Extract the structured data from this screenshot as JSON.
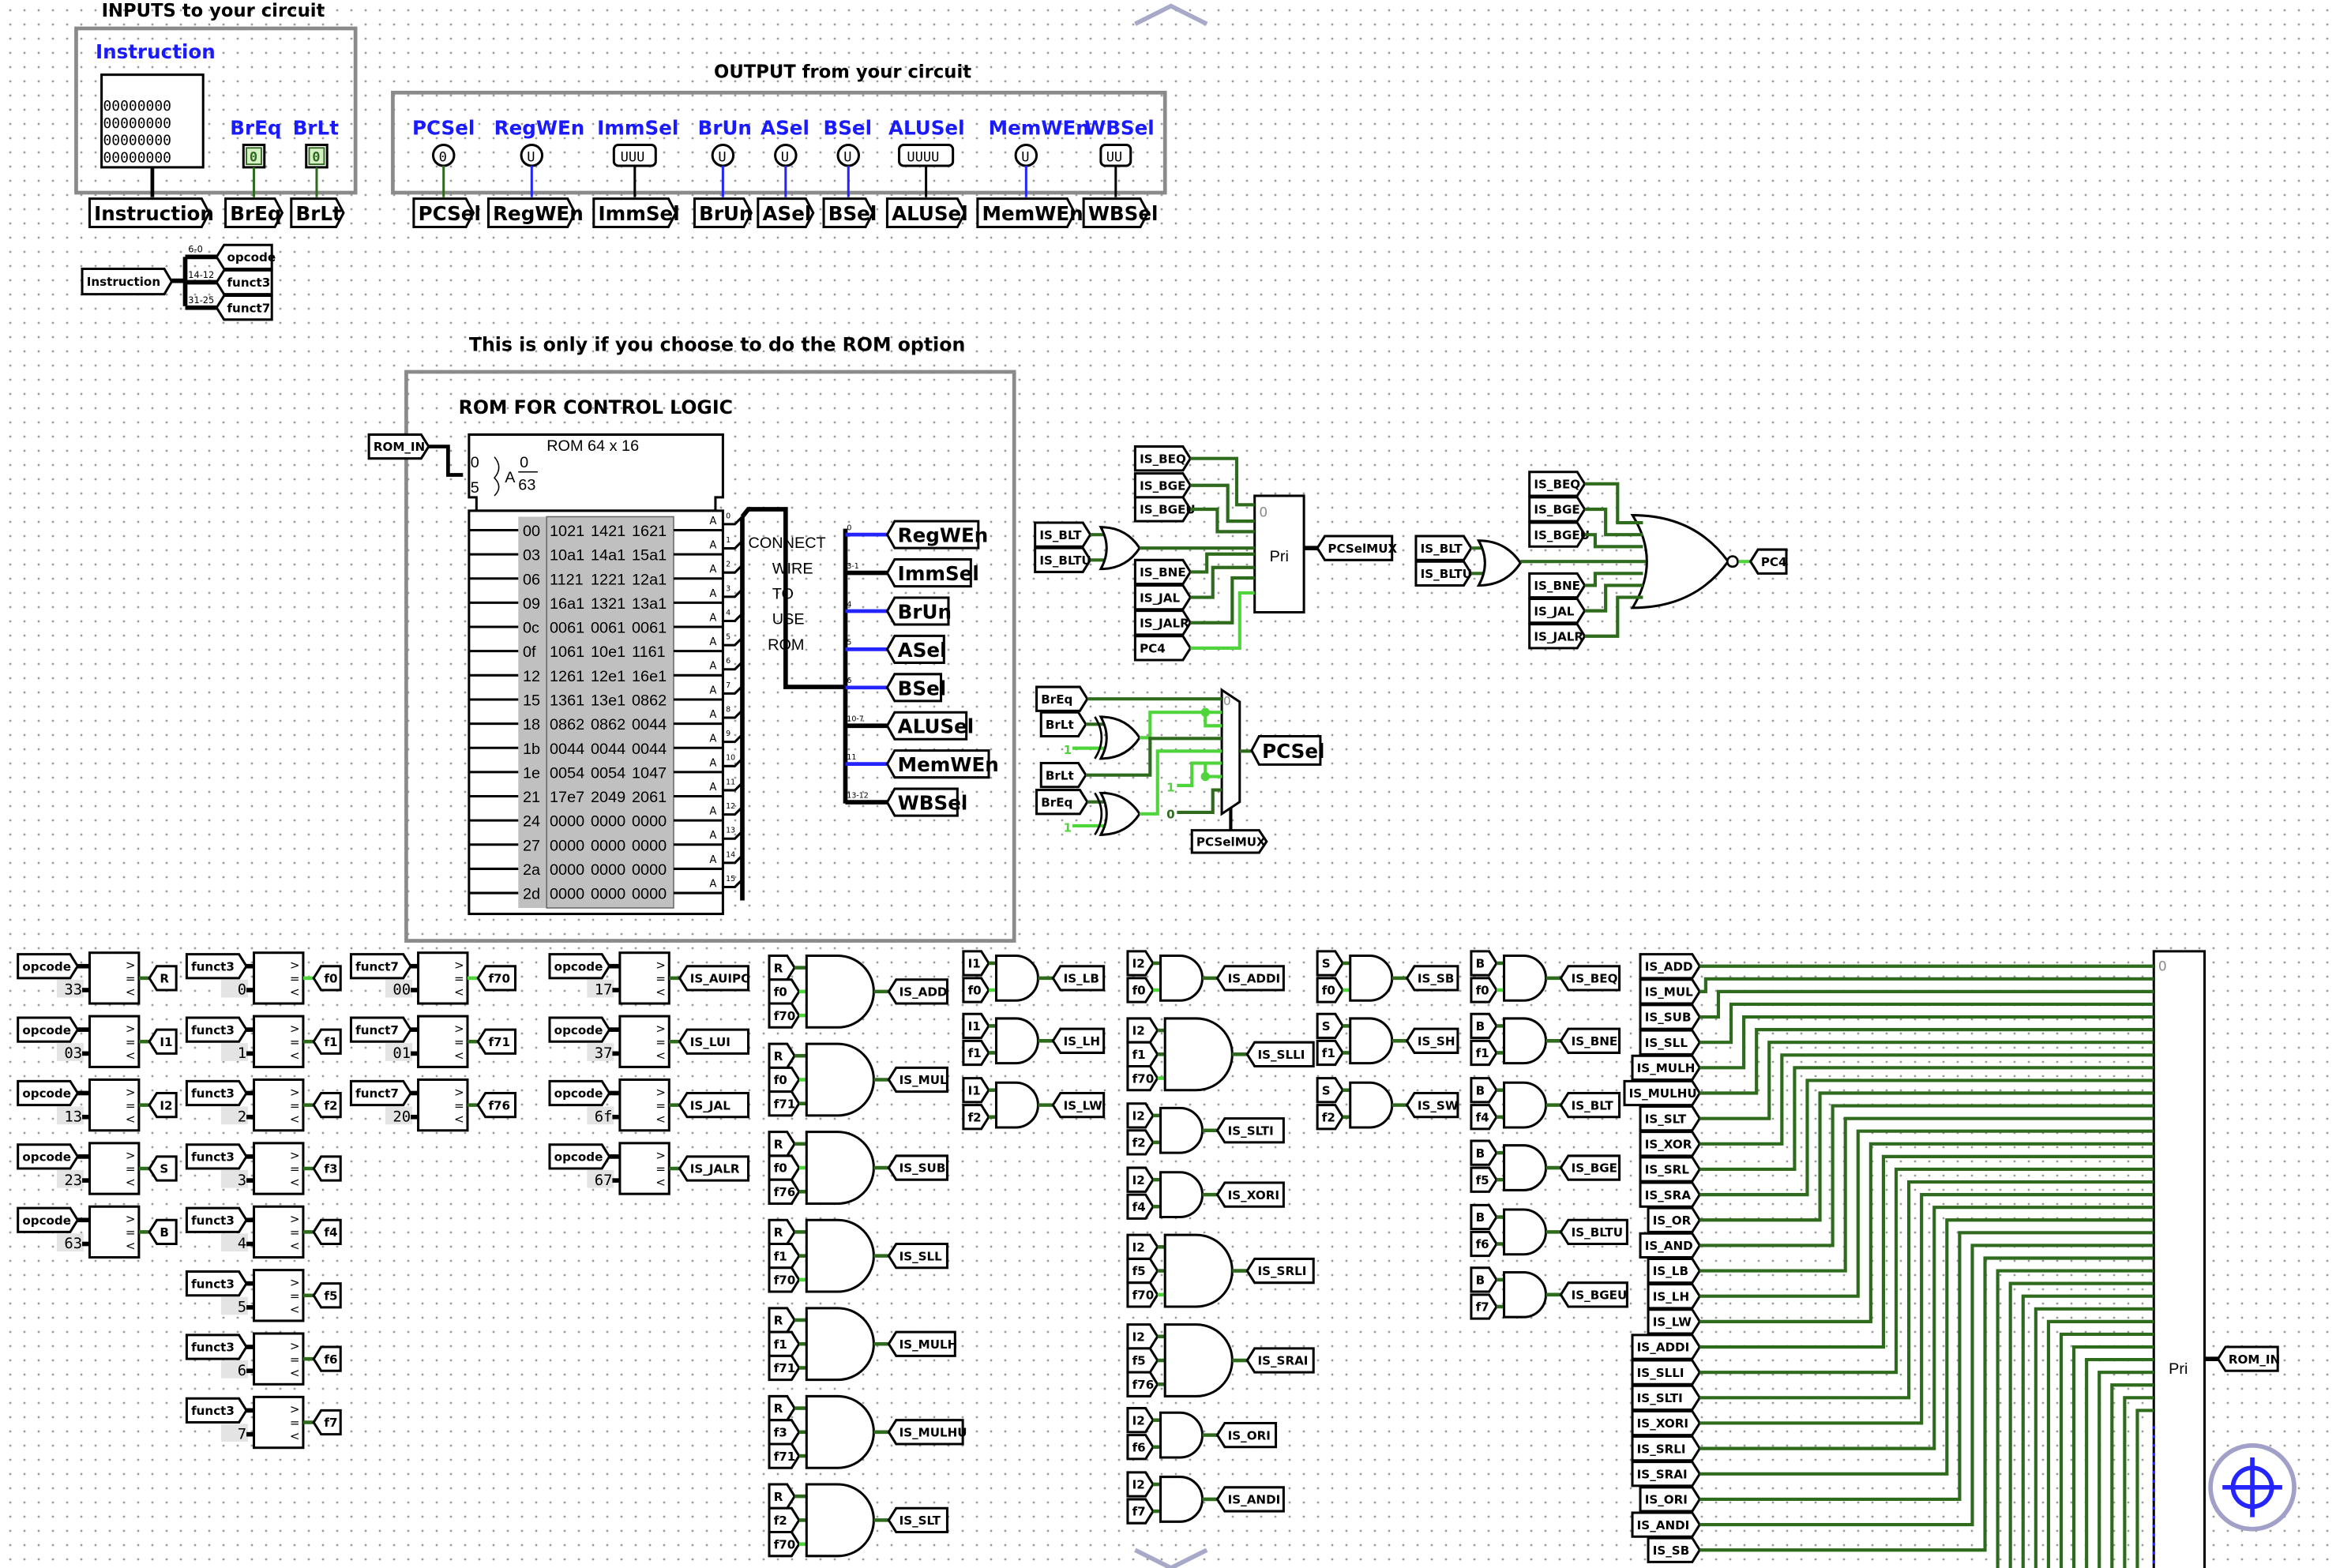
{
  "inputs": {
    "title": "INPUTS to your circuit",
    "instruction": {
      "label": "Instruction",
      "value": [
        "00000000",
        "00000000",
        "00000000",
        "00000000"
      ]
    },
    "breq": {
      "label": "BrEq",
      "value": "0"
    },
    "brlt": {
      "label": "BrLt",
      "value": "0"
    },
    "tunnels": [
      "Instruction",
      "BrEq",
      "BrLt"
    ]
  },
  "outputs": {
    "title": "OUTPUT from your circuit",
    "pins": [
      {
        "label": "PCSel",
        "value": "0",
        "state": "low"
      },
      {
        "label": "RegWEn",
        "value": "U",
        "state": "unknown"
      },
      {
        "label": "ImmSel",
        "value": "UUU",
        "state": "bus"
      },
      {
        "label": "BrUn",
        "value": "U",
        "state": "unknown"
      },
      {
        "label": "ASel",
        "value": "U",
        "state": "unknown"
      },
      {
        "label": "BSel",
        "value": "U",
        "state": "unknown"
      },
      {
        "label": "ALUSel",
        "value": "UUUU",
        "state": "bus"
      },
      {
        "label": "MemWEn",
        "value": "U",
        "state": "unknown"
      },
      {
        "label": "WBSel",
        "value": "UU",
        "state": "bus"
      }
    ]
  },
  "splitter": {
    "source": "Instruction",
    "fields": [
      {
        "bits": "6-0",
        "name": "opcode"
      },
      {
        "bits": "14-12",
        "name": "funct3"
      },
      {
        "bits": "31-25",
        "name": "funct7"
      }
    ]
  },
  "rom_section": {
    "note": "This is only if you choose to do the ROM option",
    "title": "ROM FOR CONTROL LOGIC",
    "input_tunnel": "ROM_IN",
    "rom_label": "ROM 64 x 16",
    "addr_label": "A",
    "addr_min": "0",
    "addr_max": "63",
    "pin_low": "0",
    "pin_high": "5",
    "data_pin_label": "A",
    "rows": [
      {
        "addr": "00",
        "values": [
          "1021",
          "1421",
          "1621"
        ]
      },
      {
        "addr": "03",
        "values": [
          "10a1",
          "14a1",
          "15a1"
        ]
      },
      {
        "addr": "06",
        "values": [
          "1121",
          "1221",
          "12a1"
        ]
      },
      {
        "addr": "09",
        "values": [
          "16a1",
          "1321",
          "13a1"
        ]
      },
      {
        "addr": "0c",
        "values": [
          "0061",
          "0061",
          "0061"
        ]
      },
      {
        "addr": "0f",
        "values": [
          "1061",
          "10e1",
          "1161"
        ]
      },
      {
        "addr": "12",
        "values": [
          "1261",
          "12e1",
          "16e1"
        ]
      },
      {
        "addr": "15",
        "values": [
          "1361",
          "13e1",
          "0862"
        ]
      },
      {
        "addr": "18",
        "values": [
          "0862",
          "0862",
          "0044"
        ]
      },
      {
        "addr": "1b",
        "values": [
          "0044",
          "0044",
          "0044"
        ]
      },
      {
        "addr": "1e",
        "values": [
          "0054",
          "0054",
          "1047"
        ]
      },
      {
        "addr": "21",
        "values": [
          "17e7",
          "2049",
          "2061"
        ]
      },
      {
        "addr": "24",
        "values": [
          "0000",
          "0000",
          "0000"
        ]
      },
      {
        "addr": "27",
        "values": [
          "0000",
          "0000",
          "0000"
        ]
      },
      {
        "addr": "2a",
        "values": [
          "0000",
          "0000",
          "0000"
        ]
      },
      {
        "addr": "2d",
        "values": [
          "0000",
          "0000",
          "0000"
        ]
      }
    ],
    "data_pins": [
      "0",
      "1",
      "2",
      "3",
      "4",
      "5",
      "6",
      "7",
      "8",
      "9",
      "10",
      "11",
      "12",
      "13",
      "14",
      "15"
    ],
    "connect_text": [
      "CONNECT",
      "WIRE",
      "TO",
      "USE",
      "ROM"
    ],
    "outputs": [
      {
        "bits": "0",
        "name": "RegWEn",
        "state": "unknown"
      },
      {
        "bits": "3-1",
        "name": "ImmSel",
        "state": "bus"
      },
      {
        "bits": "4",
        "name": "BrUn",
        "state": "unknown"
      },
      {
        "bits": "5",
        "name": "ASel",
        "state": "unknown"
      },
      {
        "bits": "6",
        "name": "BSel",
        "state": "unknown"
      },
      {
        "bits": "10-7",
        "name": "ALUSel",
        "state": "bus"
      },
      {
        "bits": "11",
        "name": "MemWEn",
        "state": "unknown"
      },
      {
        "bits": "13-12",
        "name": "WBSel",
        "state": "bus"
      }
    ]
  },
  "pc_logic": {
    "priority": {
      "label": "Pri",
      "first_index": "0",
      "output": "PCSelMUX",
      "inputs_top": [
        "IS_BEQ",
        "IS_BGE",
        "IS_BGEU"
      ],
      "or_inputs": [
        "IS_BLT",
        "IS_BLTU"
      ],
      "inputs_bottom": [
        "IS_BNE",
        "IS_JAL",
        "IS_JALR",
        "PC4"
      ]
    },
    "nor": {
      "inputs_top": [
        "IS_BEQ",
        "IS_BGE",
        "IS_BGEU"
      ],
      "or_inputs": [
        "IS_BLT",
        "IS_BLTU"
      ],
      "inputs_bottom": [
        "IS_BNE",
        "IS_JAL",
        "IS_JALR"
      ],
      "output": "PC4"
    },
    "mux": {
      "first_index": "0",
      "inputs": [
        "BrEq",
        "BrLt",
        "BrLt",
        "BrEq"
      ],
      "xor_constants": [
        "1",
        "1"
      ],
      "constants": [
        "1",
        "0"
      ],
      "output": "PCSel",
      "select": "PCSelMUX"
    }
  },
  "comparators": [
    {
      "input": "opcode",
      "constant": "33",
      "output": "R",
      "high": false
    },
    {
      "input": "opcode",
      "constant": "03",
      "output": "I1",
      "high": false
    },
    {
      "input": "opcode",
      "constant": "13",
      "output": "I2",
      "high": false
    },
    {
      "input": "opcode",
      "constant": "23",
      "output": "S",
      "high": false
    },
    {
      "input": "opcode",
      "constant": "63",
      "output": "B",
      "high": false
    },
    {
      "input": "funct3",
      "constant": "0",
      "output": "f0",
      "high": true
    },
    {
      "input": "funct3",
      "constant": "1",
      "output": "f1",
      "high": false
    },
    {
      "input": "funct3",
      "constant": "2",
      "output": "f2",
      "high": false
    },
    {
      "input": "funct3",
      "constant": "3",
      "output": "f3",
      "high": false
    },
    {
      "input": "funct3",
      "constant": "4",
      "output": "f4",
      "high": false
    },
    {
      "input": "funct3",
      "constant": "5",
      "output": "f5",
      "high": false
    },
    {
      "input": "funct3",
      "constant": "6",
      "output": "f6",
      "high": false
    },
    {
      "input": "funct3",
      "constant": "7",
      "output": "f7",
      "high": false
    },
    {
      "input": "funct7",
      "constant": "00",
      "output": "f70",
      "high": true
    },
    {
      "input": "funct7",
      "constant": "01",
      "output": "f71",
      "high": false
    },
    {
      "input": "funct7",
      "constant": "20",
      "output": "f76",
      "high": false
    },
    {
      "input": "opcode",
      "constant": "17",
      "output": "IS_AUIPC",
      "high": false
    },
    {
      "input": "opcode",
      "constant": "37",
      "output": "IS_LUI",
      "high": false
    },
    {
      "input": "opcode",
      "constant": "6f",
      "output": "IS_JAL",
      "high": false
    },
    {
      "input": "opcode",
      "constant": "67",
      "output": "IS_JALR",
      "high": false
    }
  ],
  "comparator_symbols": [
    ">",
    "=",
    "<"
  ],
  "and_gates": [
    {
      "inputs": [
        "R",
        "f0",
        "f70"
      ],
      "output": "IS_ADD"
    },
    {
      "inputs": [
        "R",
        "f0",
        "f71"
      ],
      "output": "IS_MUL"
    },
    {
      "inputs": [
        "R",
        "f0",
        "f76"
      ],
      "output": "IS_SUB"
    },
    {
      "inputs": [
        "R",
        "f1",
        "f70"
      ],
      "output": "IS_SLL"
    },
    {
      "inputs": [
        "R",
        "f1",
        "f71"
      ],
      "output": "IS_MULH"
    },
    {
      "inputs": [
        "R",
        "f3",
        "f71"
      ],
      "output": "IS_MULHU"
    },
    {
      "inputs": [
        "R",
        "f2",
        "f70"
      ],
      "output": "IS_SLT"
    },
    {
      "inputs": [
        "I1",
        "f0"
      ],
      "output": "IS_LB"
    },
    {
      "inputs": [
        "I1",
        "f1"
      ],
      "output": "IS_LH"
    },
    {
      "inputs": [
        "I1",
        "f2"
      ],
      "output": "IS_LW"
    },
    {
      "inputs": [
        "I2",
        "f0"
      ],
      "output": "IS_ADDI"
    },
    {
      "inputs": [
        "I2",
        "f1",
        "f70"
      ],
      "output": "IS_SLLI"
    },
    {
      "inputs": [
        "I2",
        "f2"
      ],
      "output": "IS_SLTI"
    },
    {
      "inputs": [
        "I2",
        "f4"
      ],
      "output": "IS_XORI"
    },
    {
      "inputs": [
        "I2",
        "f5",
        "f70"
      ],
      "output": "IS_SRLI"
    },
    {
      "inputs": [
        "I2",
        "f5",
        "f76"
      ],
      "output": "IS_SRAI"
    },
    {
      "inputs": [
        "I2",
        "f6"
      ],
      "output": "IS_ORI"
    },
    {
      "inputs": [
        "I2",
        "f7"
      ],
      "output": "IS_ANDI"
    },
    {
      "inputs": [
        "S",
        "f0"
      ],
      "output": "IS_SB"
    },
    {
      "inputs": [
        "S",
        "f1"
      ],
      "output": "IS_SH"
    },
    {
      "inputs": [
        "S",
        "f2"
      ],
      "output": "IS_SW"
    },
    {
      "inputs": [
        "B",
        "f0"
      ],
      "output": "IS_BEQ"
    },
    {
      "inputs": [
        "B",
        "f1"
      ],
      "output": "IS_BNE"
    },
    {
      "inputs": [
        "B",
        "f4"
      ],
      "output": "IS_BLT"
    },
    {
      "inputs": [
        "B",
        "f5"
      ],
      "output": "IS_BGE"
    },
    {
      "inputs": [
        "B",
        "f6"
      ],
      "output": "IS_BLTU"
    },
    {
      "inputs": [
        "B",
        "f7"
      ],
      "output": "IS_BGEU"
    }
  ],
  "priority_encoder": {
    "label": "Pri",
    "first_index": "0",
    "output": "ROM_IN",
    "inputs": [
      "IS_ADD",
      "IS_MUL",
      "IS_SUB",
      "IS_SLL",
      "IS_MULH",
      "IS_MULHU",
      "IS_SLT",
      "IS_XOR",
      "IS_SRL",
      "IS_SRA",
      "IS_OR",
      "IS_AND",
      "IS_LB",
      "IS_LH",
      "IS_LW",
      "IS_ADDI",
      "IS_SLLI",
      "IS_SLTI",
      "IS_XORI",
      "IS_SRLI",
      "IS_SRAI",
      "IS_ORI",
      "IS_ANDI",
      "IS_SB"
    ]
  },
  "icons": {
    "scroll_up": "chevron-up-icon",
    "scroll_down": "chevron-down-icon",
    "center": "crosshair-icon"
  },
  "colors": {
    "wire_low": "#2e6b1d",
    "wire_high": "#4fd43c",
    "wire_unknown": "#2424ff",
    "bus": "#000000",
    "frame": "#8a8a8a",
    "label_blue": "#1a1aff"
  }
}
